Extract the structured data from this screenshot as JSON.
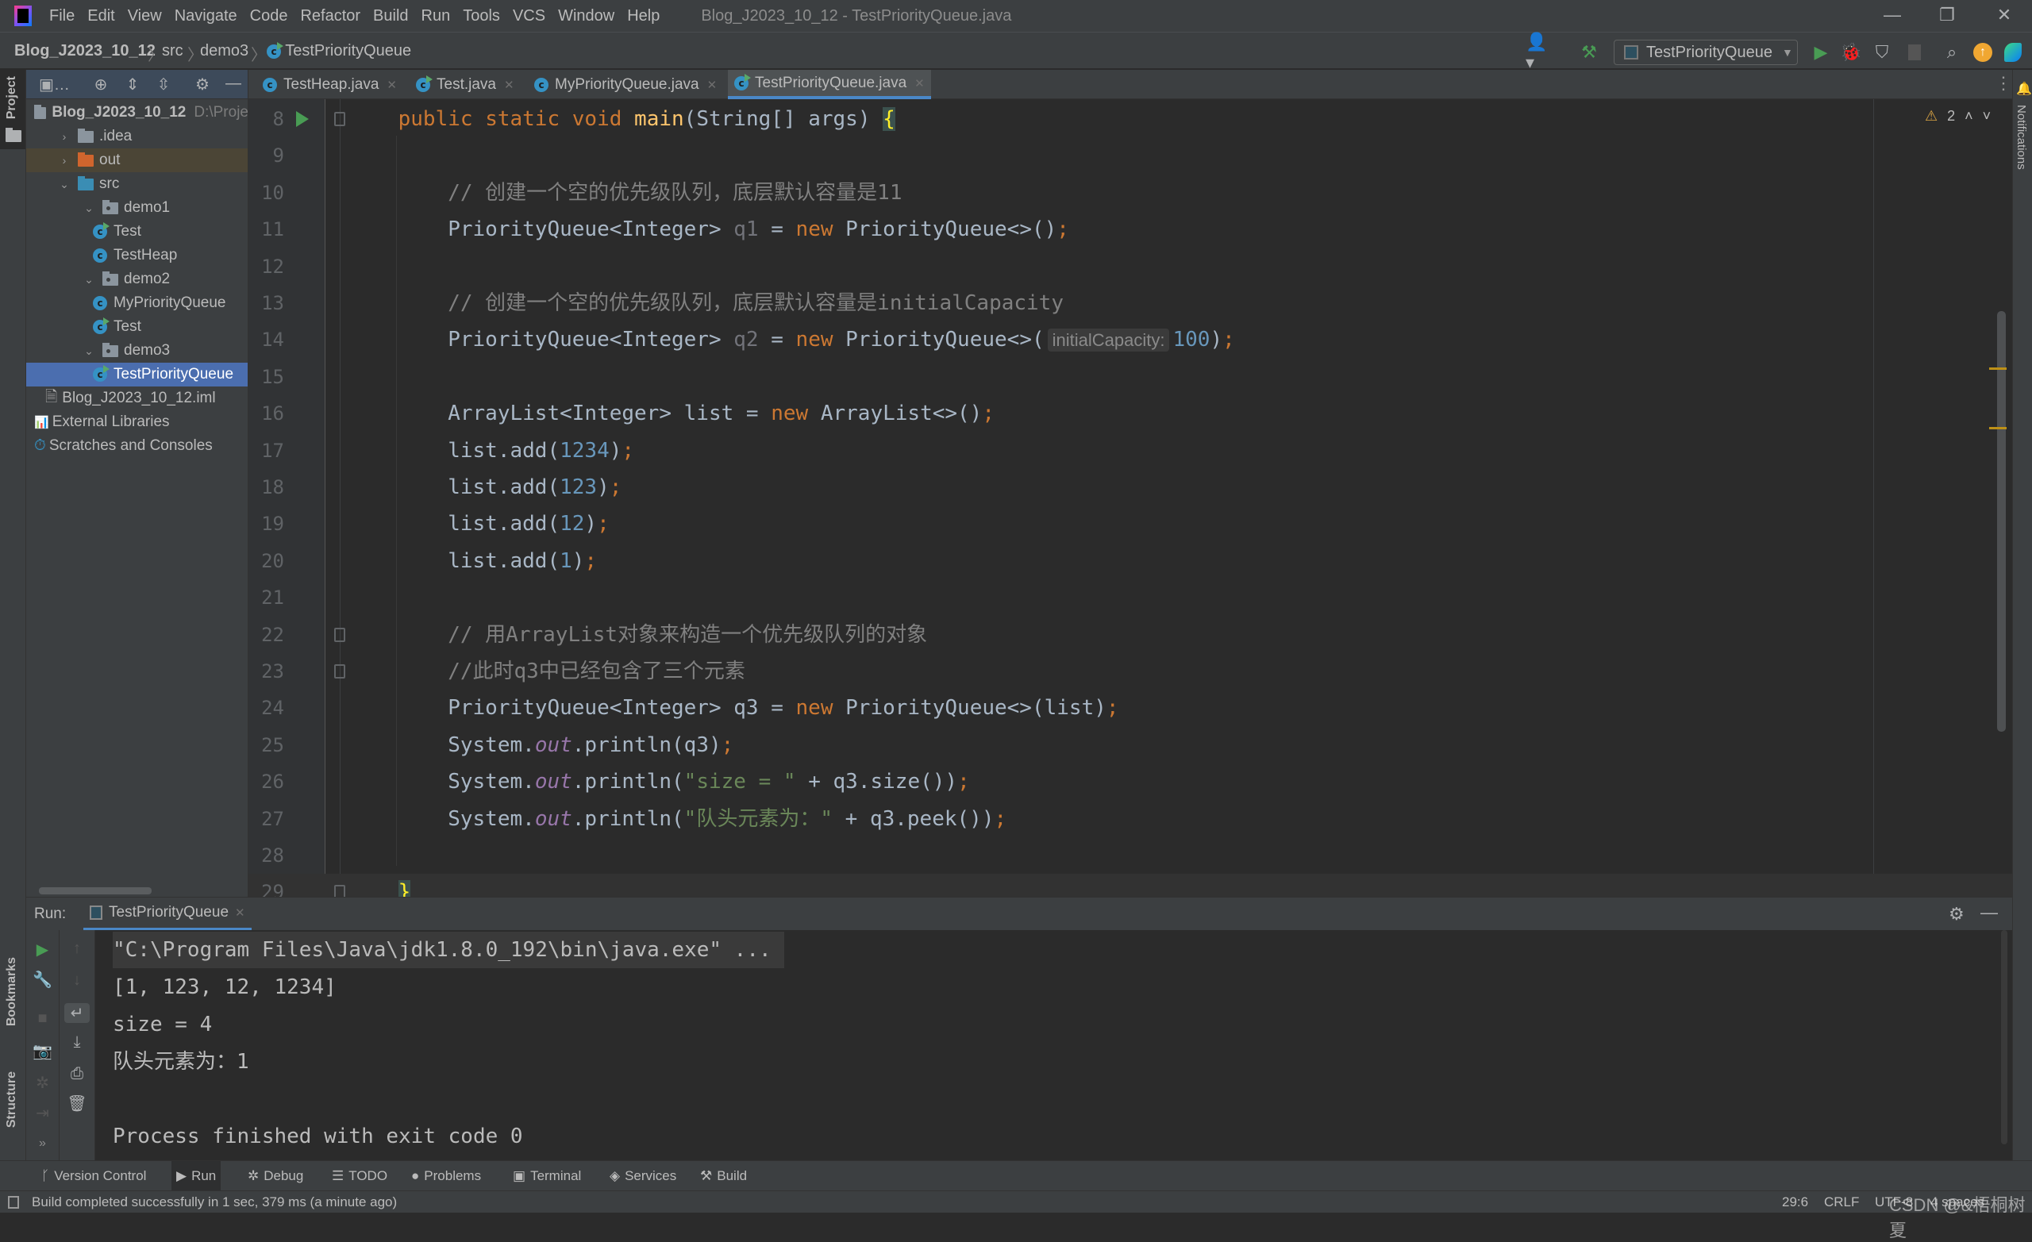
{
  "menubar": {
    "items": [
      "File",
      "Edit",
      "View",
      "Navigate",
      "Code",
      "Refactor",
      "Build",
      "Run",
      "Tools",
      "VCS",
      "Window",
      "Help"
    ],
    "window_title": "Blog_J2023_10_12 - TestPriorityQueue.java"
  },
  "breadcrumb": [
    "Blog_J2023_10_12",
    "src",
    "demo3",
    "TestPriorityQueue"
  ],
  "toolbar": {
    "run_config": "TestPriorityQueue",
    "icons": [
      "user-icon",
      "hammer-icon",
      "run-icon",
      "debug-icon",
      "coverage-icon",
      "stop-icon",
      "search-icon",
      "update-icon",
      "toolbox-icon"
    ]
  },
  "left_stripe": {
    "project": "Project",
    "bookmarks": "Bookmarks",
    "structure": "Structure"
  },
  "right_stripe": {
    "notifications": "Notifications"
  },
  "project": {
    "tree": [
      {
        "label": "Blog_J2023_10_12",
        "kind": "module",
        "level": 0,
        "hint": "D:\\Proje",
        "bold": true
      },
      {
        "label": ".idea",
        "kind": "folder",
        "level": 1,
        "expanded": false
      },
      {
        "label": "out",
        "kind": "folder-orange",
        "level": 1,
        "expanded": false
      },
      {
        "label": "src",
        "kind": "folder-blue",
        "level": 1,
        "expanded": true
      },
      {
        "label": "demo1",
        "kind": "package",
        "level": 2,
        "expanded": true
      },
      {
        "label": "Test",
        "kind": "class-run",
        "level": 3
      },
      {
        "label": "TestHeap",
        "kind": "class",
        "level": 3
      },
      {
        "label": "demo2",
        "kind": "package",
        "level": 2,
        "expanded": true
      },
      {
        "label": "MyPriorityQueue",
        "kind": "class",
        "level": 3
      },
      {
        "label": "Test",
        "kind": "class-run",
        "level": 3
      },
      {
        "label": "demo3",
        "kind": "package",
        "level": 2,
        "expanded": true
      },
      {
        "label": "TestPriorityQueue",
        "kind": "class-run",
        "level": 3,
        "selected": true
      },
      {
        "label": "Blog_J2023_10_12.iml",
        "kind": "file",
        "level": 2
      },
      {
        "label": "External Libraries",
        "kind": "libraries",
        "level": 0
      },
      {
        "label": "Scratches and Consoles",
        "kind": "scratches",
        "level": 0
      }
    ]
  },
  "tabs": [
    {
      "label": "TestHeap.java",
      "run": false
    },
    {
      "label": "Test.java",
      "run": true
    },
    {
      "label": "MyPriorityQueue.java",
      "run": false
    },
    {
      "label": "TestPriorityQueue.java",
      "run": true,
      "active": true
    }
  ],
  "editor": {
    "warnings": "2",
    "lines": [
      {
        "n": "8",
        "tokens": [
          [
            "    ",
            ""
          ],
          [
            "public static void ",
            "kw"
          ],
          [
            "main",
            "fn"
          ],
          [
            "(String[] args) ",
            ""
          ],
          [
            "{",
            "brace"
          ]
        ]
      },
      {
        "n": "9",
        "tokens": []
      },
      {
        "n": "10",
        "tokens": [
          [
            "        // 创建一个空的优先级队列，底层默认容量是11",
            "cm"
          ]
        ]
      },
      {
        "n": "11",
        "tokens": [
          [
            "        PriorityQueue<Integer> ",
            ""
          ],
          [
            "q1",
            "unused"
          ],
          [
            " = ",
            ""
          ],
          [
            "new ",
            "kw"
          ],
          [
            "PriorityQueue<>()",
            ""
          ],
          [
            ";",
            "kw"
          ]
        ]
      },
      {
        "n": "12",
        "tokens": []
      },
      {
        "n": "13",
        "tokens": [
          [
            "        // 创建一个空的优先级队列，底层默认容量是initialCapacity",
            "cm"
          ]
        ]
      },
      {
        "n": "14",
        "tokens": [
          [
            "        PriorityQueue<Integer> ",
            ""
          ],
          [
            "q2",
            "unused"
          ],
          [
            " = ",
            ""
          ],
          [
            "new ",
            "kw"
          ],
          [
            "PriorityQueue<>(",
            ""
          ],
          [
            "initialCapacity:",
            "hint"
          ],
          [
            "100",
            "num"
          ],
          [
            ")",
            ""
          ],
          [
            ";",
            "kw"
          ]
        ]
      },
      {
        "n": "15",
        "tokens": []
      },
      {
        "n": "16",
        "tokens": [
          [
            "        ArrayList<Integer> list = ",
            ""
          ],
          [
            "new ",
            "kw"
          ],
          [
            "ArrayList<>()",
            ""
          ],
          [
            ";",
            "kw"
          ]
        ]
      },
      {
        "n": "17",
        "tokens": [
          [
            "        list.add(",
            ""
          ],
          [
            "1234",
            "num"
          ],
          [
            ")",
            ""
          ],
          [
            ";",
            "kw"
          ]
        ]
      },
      {
        "n": "18",
        "tokens": [
          [
            "        list.add(",
            ""
          ],
          [
            "123",
            "num"
          ],
          [
            ")",
            ""
          ],
          [
            ";",
            "kw"
          ]
        ]
      },
      {
        "n": "19",
        "tokens": [
          [
            "        list.add(",
            ""
          ],
          [
            "12",
            "num"
          ],
          [
            ")",
            ""
          ],
          [
            ";",
            "kw"
          ]
        ]
      },
      {
        "n": "20",
        "tokens": [
          [
            "        list.add(",
            ""
          ],
          [
            "1",
            "num"
          ],
          [
            ")",
            ""
          ],
          [
            ";",
            "kw"
          ]
        ]
      },
      {
        "n": "21",
        "tokens": []
      },
      {
        "n": "22",
        "tokens": [
          [
            "        // 用ArrayList对象来构造一个优先级队列的对象",
            "cm"
          ]
        ]
      },
      {
        "n": "23",
        "tokens": [
          [
            "        //此时q3中已经包含了三个元素",
            "cm"
          ]
        ]
      },
      {
        "n": "24",
        "tokens": [
          [
            "        PriorityQueue<Integer> q3 = ",
            ""
          ],
          [
            "new ",
            "kw"
          ],
          [
            "PriorityQueue<>(list)",
            ""
          ],
          [
            ";",
            "kw"
          ]
        ]
      },
      {
        "n": "25",
        "tokens": [
          [
            "        System.",
            ""
          ],
          [
            "out",
            "static"
          ],
          [
            ".println(q3)",
            ""
          ],
          [
            ";",
            "kw"
          ]
        ]
      },
      {
        "n": "26",
        "tokens": [
          [
            "        System.",
            ""
          ],
          [
            "out",
            "static"
          ],
          [
            ".println(",
            ""
          ],
          [
            "\"size = \"",
            "str"
          ],
          [
            " + q3.size())",
            ""
          ],
          [
            ";",
            "kw"
          ]
        ]
      },
      {
        "n": "27",
        "tokens": [
          [
            "        System.",
            ""
          ],
          [
            "out",
            "static"
          ],
          [
            ".println(",
            ""
          ],
          [
            "\"队头元素为：\"",
            "str"
          ],
          [
            " + q3.peek())",
            ""
          ],
          [
            ";",
            "kw"
          ]
        ]
      },
      {
        "n": "28",
        "tokens": []
      },
      {
        "n": "29",
        "tokens": [
          [
            "    ",
            ""
          ],
          [
            "}",
            "brace"
          ]
        ]
      }
    ]
  },
  "run": {
    "label": "Run:",
    "tab": "TestPriorityQueue",
    "console": [
      "\"C:\\Program Files\\Java\\jdk1.8.0_192\\bin\\java.exe\" ...",
      "[1, 123, 12, 1234]",
      "size = 4",
      "队头元素为：1",
      "",
      "Process finished with exit code 0"
    ]
  },
  "bottom_tabs": [
    "Version Control",
    "Run",
    "Debug",
    "TODO",
    "Problems",
    "Terminal",
    "Services",
    "Build"
  ],
  "status": {
    "message": "Build completed successfully in 1 sec, 379 ms (a minute ago)",
    "position": "29:6",
    "line_sep": "CRLF",
    "encoding": "UTF-8",
    "indent": "4 spaces",
    "watermark": "CSDN @&梧桐树夏"
  },
  "colors": {
    "keyword": "#cc7832",
    "method": "#ffc66d",
    "comment": "#808080",
    "number": "#6897bb",
    "string": "#6a8759",
    "static": "#9876aa",
    "selection": "#4b6eaf",
    "accent": "#4a88c7"
  }
}
